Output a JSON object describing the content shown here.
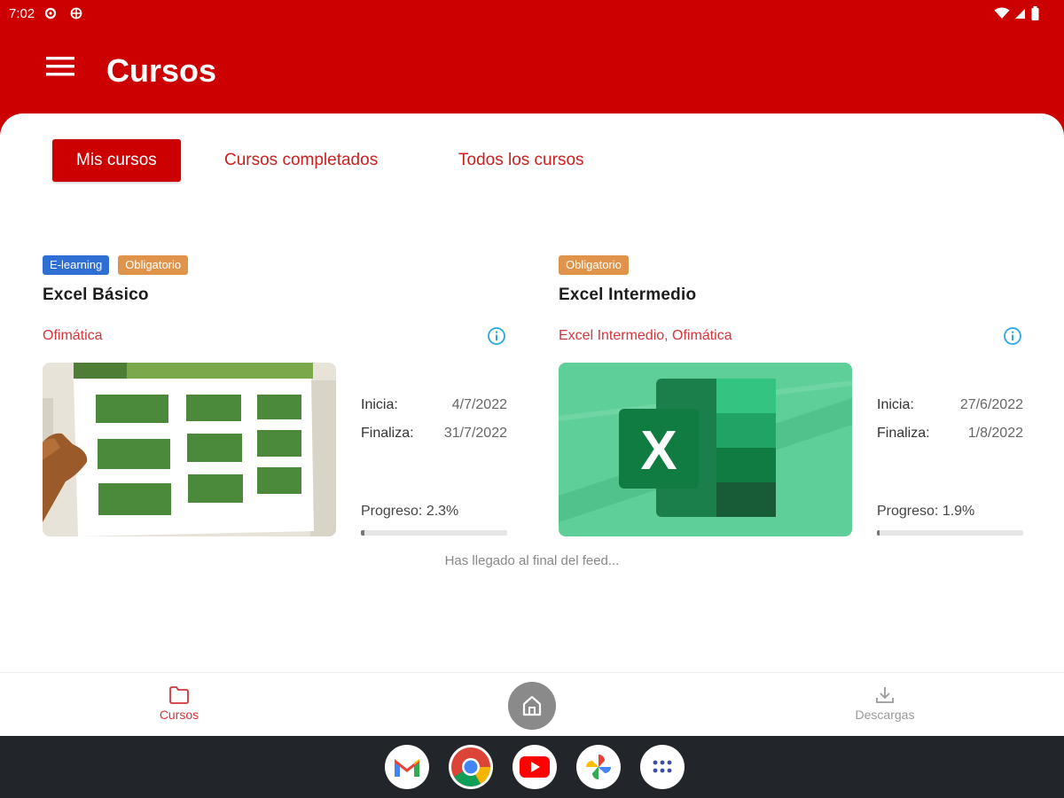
{
  "status_bar": {
    "time": "7:02",
    "icons": [
      "settings-icon",
      "target-icon",
      "wifi-icon",
      "signal-icon",
      "battery-icon"
    ]
  },
  "app_bar": {
    "title": "Cursos",
    "menu_icon": "hamburger-menu-icon"
  },
  "tabs": [
    {
      "label": "Mis cursos",
      "active": true
    },
    {
      "label": "Cursos completados",
      "active": false
    },
    {
      "label": "Todos los cursos",
      "active": false
    }
  ],
  "courses": [
    {
      "badges": [
        "E-learning",
        "Obligatorio"
      ],
      "title": "Excel Básico",
      "category": "Ofimática",
      "start_label": "Inicia:",
      "start": "4/7/2022",
      "end_label": "Finaliza:",
      "end": "31/7/2022",
      "progress_label": "Progreso: 2.3%",
      "progress": 2.3
    },
    {
      "badges": [
        "Obligatorio"
      ],
      "title": "Excel Intermedio",
      "category": "Excel Intermedio, Ofimática",
      "start_label": "Inicia:",
      "start": "27/6/2022",
      "end_label": "Finaliza:",
      "end": "1/8/2022",
      "progress_label": "Progreso: 1.9%",
      "progress": 1.9
    }
  ],
  "feed_end": "Has llegado al final del feed...",
  "bottom_nav": {
    "courses": "Cursos",
    "downloads": "Descargas"
  },
  "dock_apps": [
    "gmail-icon",
    "chrome-icon",
    "youtube-icon",
    "photos-icon",
    "app-drawer-icon"
  ],
  "colors": {
    "primary": "#cc0000",
    "badge_blue": "#2f6fd3",
    "badge_orange": "#e0944b",
    "accent_text": "#d1363b"
  }
}
